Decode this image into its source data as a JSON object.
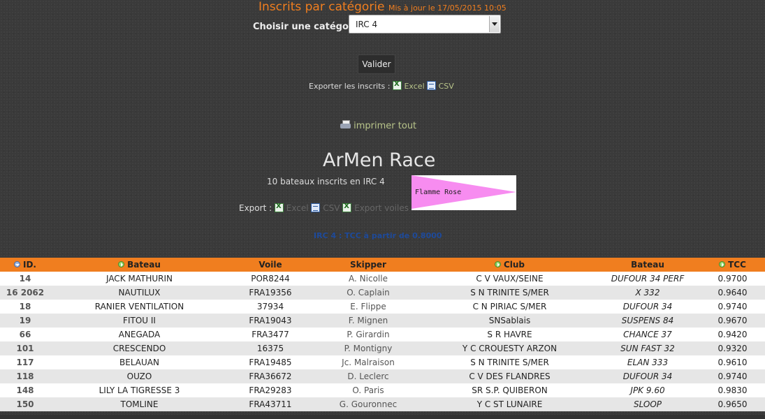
{
  "header": {
    "title": "Inscrits par catégorie",
    "updated": "Mis à jour le 17/05/2015 10:05"
  },
  "filter": {
    "label": "Choisir une catégorie",
    "selected": "IRC 4",
    "validate_label": "Valider"
  },
  "export_top": {
    "prefix": "Exporter les inscrits :",
    "excel": "Excel",
    "csv": "CSV"
  },
  "print_label": "imprimer tout",
  "race": {
    "title": "ArMen Race",
    "count_text": "10 bateaux inscrits en IRC 4",
    "flag_label": "Flamme Rose",
    "flag_color": "#f78cf0"
  },
  "export_bottom": {
    "prefix": "Export :",
    "excel": "Excel",
    "csv": "CSV",
    "sails": "Export voiles"
  },
  "tcc_note": "IRC 4 : TCC à partir de 0.8000",
  "colors": {
    "accent": "#f07e1f",
    "row_alt": "#e6e6e6"
  },
  "table": {
    "headers": [
      "ID.",
      "Bateau",
      "Voile",
      "Skipper",
      "Club",
      "Bateau",
      "TCC"
    ],
    "rows": [
      [
        "14",
        "JACK MATHURIN",
        "POR8244",
        "A. Nicolle",
        "C V VAUX/SEINE",
        "DUFOUR 34 PERF",
        "0.9700"
      ],
      [
        "16 2062",
        "NAUTILUX",
        "FRA19356",
        "O. Caplain",
        "S N TRINITE S/MER",
        "X 332",
        "0.9640"
      ],
      [
        "18",
        "RANIER VENTILATION",
        "37934",
        "E. Flippe",
        "C N PIRIAC S/MER",
        "DUFOUR 34",
        "0.9740"
      ],
      [
        "19",
        "FITOU II",
        "FRA19043",
        "F. Mignen",
        "SNSablais",
        "SUSPENS 84",
        "0.9670"
      ],
      [
        "66",
        "ANEGADA",
        "FRA3477",
        "P. Girardin",
        "S R HAVRE",
        "CHANCE 37",
        "0.9420"
      ],
      [
        "101",
        "CRESCENDO",
        "16375",
        "P. Montigny",
        "Y C CROUESTY ARZON",
        "SUN FAST 32",
        "0.9320"
      ],
      [
        "117",
        "BELAUAN",
        "FRA19485",
        "Jc. Malraison",
        "S N TRINITE S/MER",
        "ELAN 333",
        "0.9610"
      ],
      [
        "118",
        "OUZO",
        "FRA36672",
        "D. Leclerc",
        "C V DES FLANDRES",
        "DUFOUR 34",
        "0.9740"
      ],
      [
        "148",
        "LILY LA TIGRESSE 3",
        "FRA29283",
        "O. Paris",
        "SR S.P. QUIBERON",
        "JPK 9.60",
        "0.9830"
      ],
      [
        "150",
        "TOMLINE",
        "FRA43711",
        "G. Gouronnec",
        "Y C ST LUNAIRE",
        "SLOOP",
        "0.9650"
      ]
    ]
  }
}
